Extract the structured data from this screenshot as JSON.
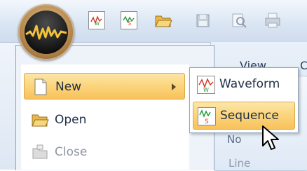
{
  "ribbon": {
    "tab_view": "View",
    "tab_partial": "C",
    "partial_label_no": "No",
    "partial_label_line": "Line"
  },
  "quick_access_toolbar": {
    "icons": [
      "new-waveform-icon",
      "new-sequence-icon",
      "open-folder-icon",
      "save-disk-icon",
      "print-preview-icon",
      "print-icon"
    ]
  },
  "office_menu": {
    "items": [
      {
        "label": "New",
        "icon": "new-document-icon",
        "has_submenu": true,
        "highlighted": true
      },
      {
        "label": "Open",
        "icon": "open-folder-icon",
        "highlighted": false
      },
      {
        "label": "Close",
        "icon": "close-folder-icon",
        "disabled": true
      }
    ]
  },
  "new_submenu": {
    "items": [
      {
        "label": "Waveform",
        "icon": "waveform-icon"
      },
      {
        "label": "Sequence",
        "icon": "sequence-icon",
        "highlighted": true
      }
    ]
  },
  "colors": {
    "highlight": "#fbd67f",
    "accent_green": "#2a9a3a",
    "accent_red": "#d03a2a"
  }
}
